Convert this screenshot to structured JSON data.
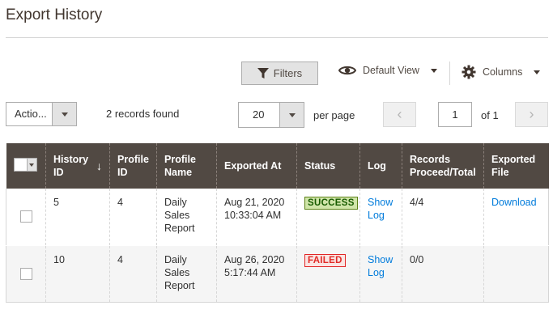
{
  "page": {
    "title": "Export History"
  },
  "toolbar": {
    "filters_label": "Filters",
    "view_label": "Default View",
    "columns_label": "Columns"
  },
  "actions": {
    "label": "Actio..."
  },
  "records_found": "2 records found",
  "pagination": {
    "per_page_value": "20",
    "per_page_label": "per page",
    "prev_glyph": "‹",
    "next_glyph": "›",
    "current_page": "1",
    "of_label": "of 1"
  },
  "grid": {
    "columns": [
      {
        "label": "History ID",
        "sorted": true,
        "sort_glyph": "↓"
      },
      {
        "label": "Profile ID"
      },
      {
        "label": "Profile Name"
      },
      {
        "label": "Exported At"
      },
      {
        "label": "Status"
      },
      {
        "label": "Log"
      },
      {
        "label": "Records Proceed/Total"
      },
      {
        "label": "Exported File"
      }
    ],
    "rows": [
      {
        "history_id": "5",
        "profile_id": "4",
        "profile_name": "Daily Sales Report",
        "exported_at": "Aug 21, 2020 10:33:04 AM",
        "status": "SUCCESS",
        "log": "Show Log",
        "records": "4/4",
        "exported_file": "Download"
      },
      {
        "history_id": "10",
        "profile_id": "4",
        "profile_name": "Daily Sales Report",
        "exported_at": "Aug 26, 2020 5:17:44 AM",
        "status": "FAILED",
        "log": "Show Log",
        "records": "0/0",
        "exported_file": ""
      }
    ]
  },
  "colors": {
    "header_bg": "#514943",
    "link": "#007bdb",
    "success_bg": "#d0e5a9",
    "failed_text": "#e02b27"
  },
  "icons": {
    "filters": "funnel-icon",
    "view": "eye-icon",
    "columns": "gear-icon"
  }
}
